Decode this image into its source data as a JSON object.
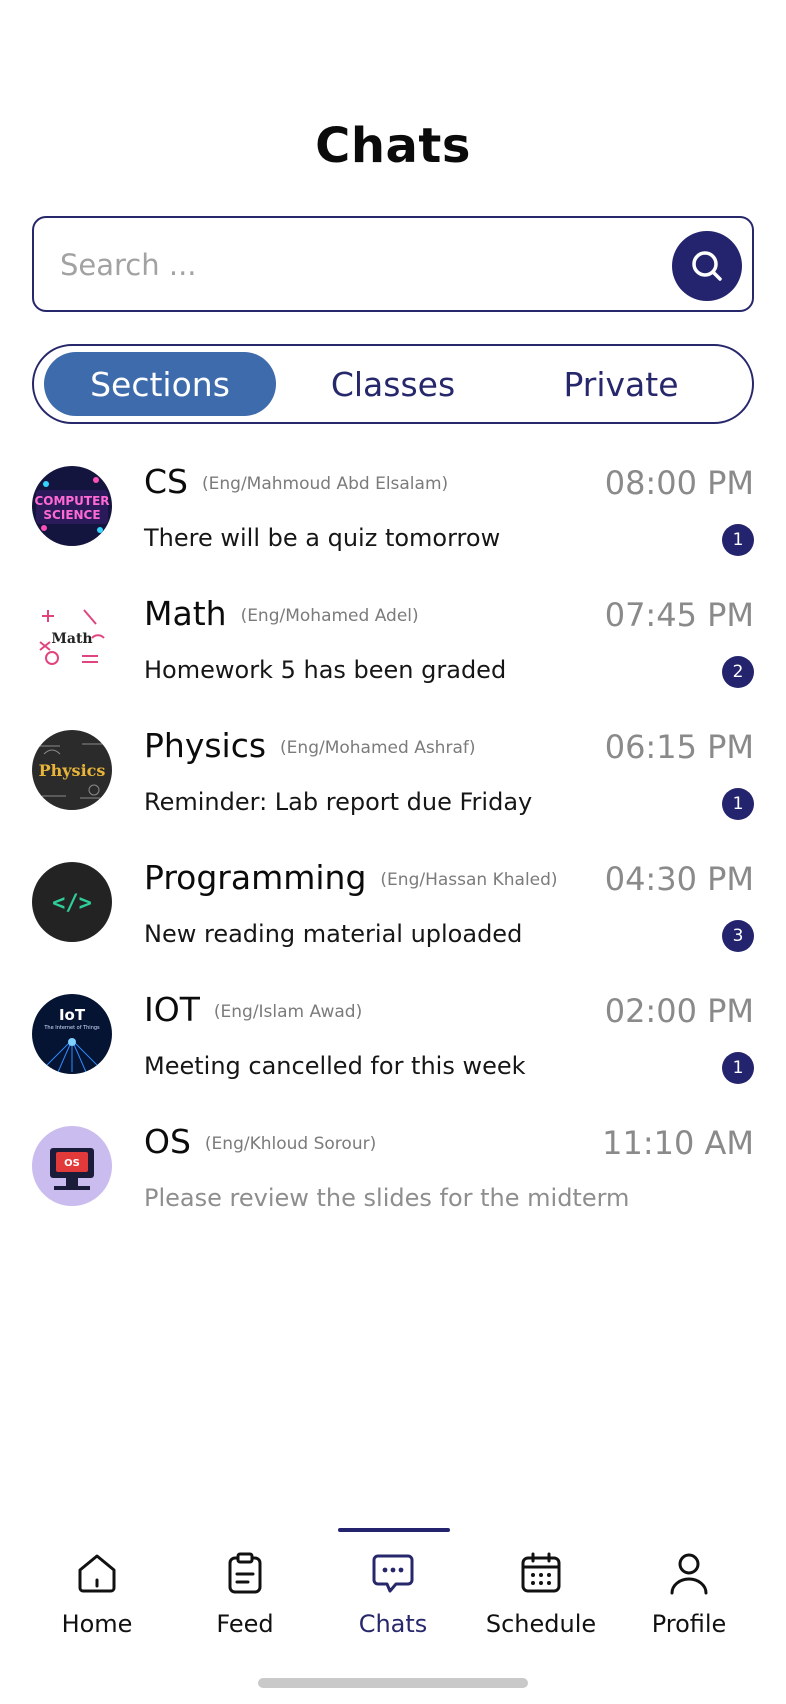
{
  "header": {
    "title": "Chats"
  },
  "search": {
    "placeholder": "Search ...",
    "icon": "search-icon"
  },
  "tabs": [
    {
      "label": "Sections",
      "active": true
    },
    {
      "label": "Classes",
      "active": false
    },
    {
      "label": "Private",
      "active": false
    }
  ],
  "chats": [
    {
      "name": "CS",
      "teacher": "(Eng/Mahmoud Abd Elsalam)",
      "time": "08:00 PM",
      "message": "There will be a quiz tomorrow",
      "unread": "1",
      "avatar_text": [
        "COMPUTER",
        "SCIENCE"
      ]
    },
    {
      "name": "Math",
      "teacher": "(Eng/Mohamed Adel)",
      "time": "07:45 PM",
      "message": "Homework 5 has been graded",
      "unread": "2",
      "avatar_text": [
        "Math"
      ]
    },
    {
      "name": "Physics",
      "teacher": "(Eng/Mohamed Ashraf)",
      "time": "06:15 PM",
      "message": "Reminder: Lab report due Friday",
      "unread": "1",
      "avatar_text": [
        "Physics"
      ]
    },
    {
      "name": "Programming",
      "teacher": "(Eng/Hassan Khaled)",
      "time": "04:30 PM",
      "message": "New reading material uploaded",
      "unread": "3",
      "avatar_text": [
        "</>"
      ]
    },
    {
      "name": "IOT",
      "teacher": "(Eng/Islam Awad)",
      "time": "02:00 PM",
      "message": "Meeting cancelled for this week",
      "unread": "1",
      "avatar_text": [
        "IoT",
        "The Internet of Things"
      ]
    },
    {
      "name": "OS",
      "teacher": "(Eng/Khloud Sorour)",
      "time": "11:10 AM",
      "message": "Please review the slides for the midterm",
      "unread": null,
      "avatar_text": [
        "OS"
      ]
    }
  ],
  "nav": [
    {
      "label": "Home",
      "icon": "home-icon",
      "active": false
    },
    {
      "label": "Feed",
      "icon": "clipboard-icon",
      "active": false
    },
    {
      "label": "Chats",
      "icon": "chat-bubble-icon",
      "active": true
    },
    {
      "label": "Schedule",
      "icon": "calendar-icon",
      "active": false
    },
    {
      "label": "Profile",
      "icon": "user-icon",
      "active": false
    }
  ],
  "colors": {
    "primary": "#24246e",
    "tab_active": "#3e6bab",
    "muted_text": "#8a8a8a"
  }
}
